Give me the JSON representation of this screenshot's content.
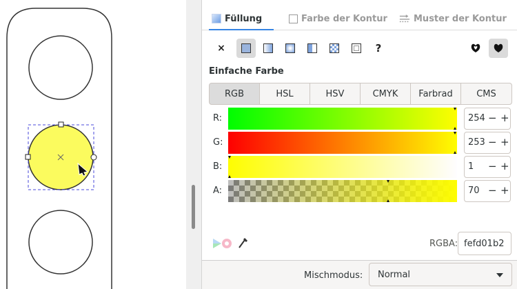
{
  "tabs": [
    {
      "label": "Füllung",
      "icon": "fill-icon",
      "active": true
    },
    {
      "label": "Farbe der Kontur",
      "icon": "stroke-paint-icon",
      "active": false
    },
    {
      "label": "Muster der Kontur",
      "icon": "stroke-style-icon",
      "active": false
    }
  ],
  "paint_types": [
    "none-icon",
    "flat-color-icon",
    "linear-gradient-icon",
    "radial-gradient-icon",
    "mesh-gradient-icon",
    "pattern-icon",
    "swatch-icon",
    "unset-icon"
  ],
  "fill_rules": [
    "fill-rule-evenodd-icon",
    "fill-rule-nonzero-icon"
  ],
  "section_title": "Einfache Farbe",
  "color_modes": [
    "RGB",
    "HSL",
    "HSV",
    "CMYK",
    "Farbrad",
    "CMS"
  ],
  "active_mode": "RGB",
  "sliders": [
    {
      "label": "R:",
      "value": "254"
    },
    {
      "label": "G:",
      "value": "253"
    },
    {
      "label": "B:",
      "value": "1"
    },
    {
      "label": "A:",
      "value": "70"
    }
  ],
  "spin_minus": "−",
  "spin_plus": "+",
  "unset_mark": "×",
  "question_mark": "?",
  "rgba_label": "RGBA:",
  "rgba_value": "fefd01b2",
  "blend_label": "Mischmodus:",
  "blend_value": "Normal",
  "colors": {
    "fill": "#fefd01",
    "accent": "#3584e4",
    "selection": "#4a4adb"
  }
}
